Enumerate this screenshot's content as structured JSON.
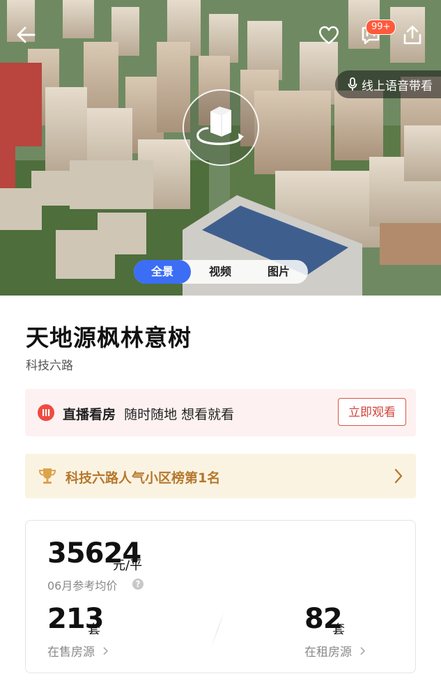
{
  "header": {
    "back_icon": "arrow-left-icon",
    "favorite_icon": "heart-icon",
    "message_icon": "chat-icon",
    "message_badge": "99+",
    "share_icon": "share-icon",
    "voice_guide": "线上语音带看"
  },
  "media_tabs": [
    "全景",
    "视频",
    "图片"
  ],
  "community": {
    "name": "天地源枫林意树",
    "road": "科技六路"
  },
  "live": {
    "title": "直播看房",
    "slogan": "随时随地 想看就看",
    "button": "立即观看"
  },
  "rank": {
    "text": "科技六路人气小区榜第1名"
  },
  "stats": {
    "price": "35624",
    "price_unit": "元/平",
    "price_label": "06月参考均价",
    "sale_count": "213",
    "sale_unit": "套",
    "sale_label": "在售房源",
    "rent_count": "82",
    "rent_unit": "套",
    "rent_label": "在租房源"
  },
  "colors": {
    "accent_blue": "#3b6ef5",
    "live_red": "#ef4a40",
    "rank_gold": "#b5782e"
  }
}
